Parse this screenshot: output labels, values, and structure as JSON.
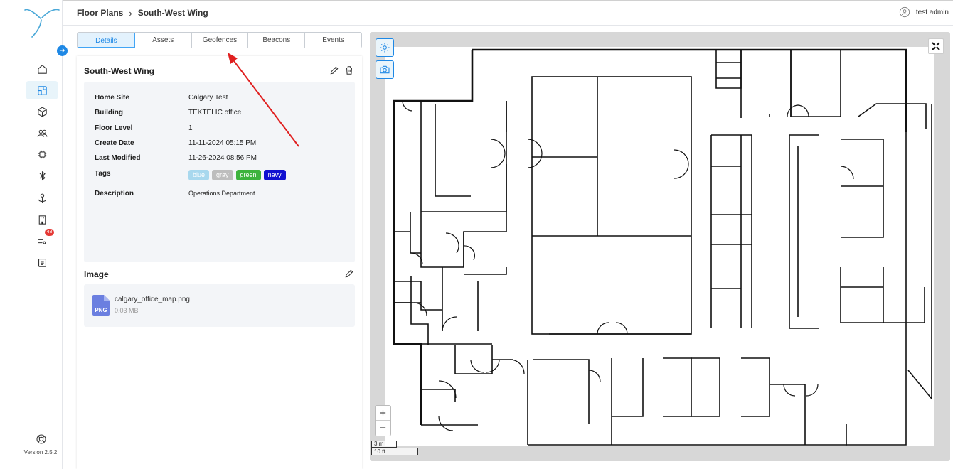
{
  "breadcrumb": {
    "parent": "Floor Plans",
    "current": "South-West Wing"
  },
  "user": {
    "name": "test admin"
  },
  "sidebar": {
    "version": "Version 2.5.2",
    "alerts_badge": "48"
  },
  "tabs": [
    "Details",
    "Assets",
    "Geofences",
    "Beacons",
    "Events"
  ],
  "details": {
    "title": "South-West Wing",
    "fields": [
      {
        "label": "Home Site",
        "value": "Calgary Test"
      },
      {
        "label": "Building",
        "value": "TEKTELIC office"
      },
      {
        "label": "Floor Level",
        "value": "1"
      },
      {
        "label": "Create Date",
        "value": "11-11-2024 05:15 PM"
      },
      {
        "label": "Last Modified",
        "value": "11-26-2024 08:56 PM"
      }
    ],
    "tags_label": "Tags",
    "tags": [
      {
        "name": "blue",
        "color": "#a8d8ee"
      },
      {
        "name": "gray",
        "color": "#bdbdbd"
      },
      {
        "name": "green",
        "color": "#3db33d"
      },
      {
        "name": "navy",
        "color": "#1010d0"
      }
    ],
    "description_label": "Description",
    "description": "Operations Department"
  },
  "image": {
    "title": "Image",
    "file_type": "PNG",
    "file_name": "calgary_office_map.png",
    "file_size": "0.03 MB"
  },
  "map": {
    "zoom_in": "+",
    "zoom_out": "−",
    "scale_metric": "3 m",
    "scale_imperial": "10 ft"
  },
  "colors": {
    "accent": "#1e88e5",
    "annotation_arrow": "#e02020"
  }
}
